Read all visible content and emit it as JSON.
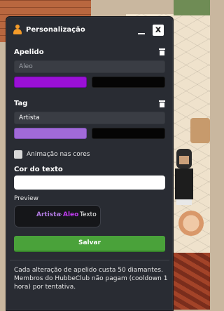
{
  "window": {
    "title": "Personalização",
    "close_label": "x",
    "icons": {
      "title": "user-icon",
      "minimize": "minimize-icon",
      "close": "close-icon"
    }
  },
  "apelido": {
    "label": "Apelido",
    "placeholder": "Aleo",
    "value": "",
    "color_primary": "#9a10d6",
    "color_secondary": "#050505",
    "delete_icon": "trash-icon"
  },
  "tag": {
    "label": "Tag",
    "value": "Artista",
    "color_primary": "#a16ad8",
    "color_secondary": "#050505",
    "delete_icon": "trash-icon"
  },
  "animacao": {
    "label": "Animação nas cores",
    "checked": false
  },
  "cor_do_texto": {
    "label": "Cor do texto",
    "value": ""
  },
  "preview": {
    "label": "Preview",
    "tag": "Artista",
    "separator": "›",
    "name": "Aleo",
    "text": "Texto",
    "tag_color": "#b07ae0",
    "name_color": "#c23cf2"
  },
  "save_label": "Salvar",
  "footer": "Cada alteração de apelido custa 50 diamantes. Membros do HubbeClub não pagam (cooldown 1 hora) por tentativa."
}
